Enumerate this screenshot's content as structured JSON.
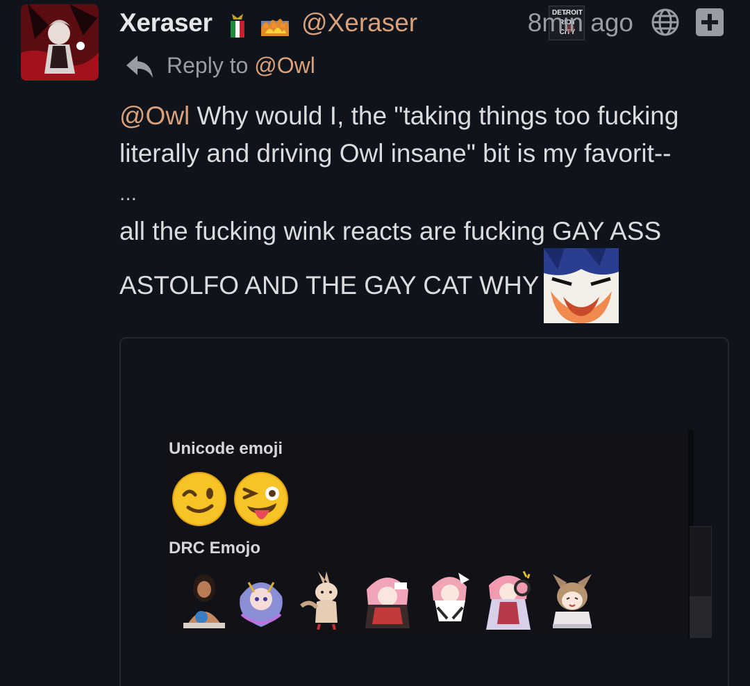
{
  "post": {
    "username": "Xeraser",
    "handle": "@Xeraser",
    "badge_text": "DETROIT RIOT CITY",
    "timestamp": "8min ago",
    "reply_prefix": "Reply to",
    "reply_handle": "@Owl",
    "body": {
      "mention": "@Owl",
      "line1_rest": " Why would I, the \"taking things too fucking",
      "line2": "literally and driving Owl insane\" bit is my favorit--",
      "ellipsis": "...",
      "line3": "all the fucking wink reacts are fucking GAY ASS",
      "line4": "ASTOLFO AND THE GAY CAT WHY"
    },
    "icons": {
      "flair1": "italy-flag-icon",
      "flair2": "fire-building-icon",
      "globe": "globe-icon",
      "plus": "plus-icon",
      "reply": "reply-arrow-icon"
    }
  },
  "embed": {
    "unicode_section": "Unicode emoji",
    "unicode_emojis": [
      "winking-face",
      "winking-face-with-tongue"
    ],
    "drc_section": "DRC Emojo",
    "drc_emojis": [
      "drc-emoji-1",
      "drc-emoji-2",
      "drc-emoji-3",
      "drc-emoji-4",
      "drc-emoji-5",
      "drc-emoji-6",
      "drc-emoji-7"
    ]
  },
  "colors": {
    "background": "#0f131b",
    "accent_handle": "#d9a07a",
    "muted": "#9a9ca3",
    "text": "#dcdcde"
  }
}
